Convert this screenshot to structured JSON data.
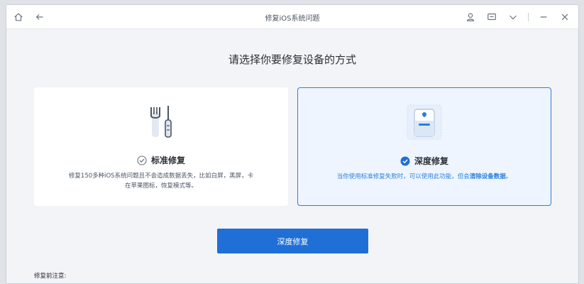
{
  "window": {
    "title": "修复iOS系统问题"
  },
  "titlebar": {
    "left_icons": [
      "home-icon",
      "back-arrow-icon"
    ],
    "right_icons": [
      "user-icon",
      "chat-icon",
      "chevron-down-icon",
      "minimize-icon",
      "close-icon"
    ]
  },
  "main": {
    "heading": "请选择你要修复设备的方式"
  },
  "modes": {
    "standard": {
      "title": "标准修复",
      "desc_line1": "修复150多种iOS系统问题且不会造成数据丢失，比如白屏，黑屏，卡",
      "desc_line2": "在苹果图标，恢复模式等。",
      "icon": "tools-icon",
      "selected": false
    },
    "deep": {
      "title": "深度修复",
      "desc_prefix": "当你使用标准修复失败时，可以使用此功能，但会",
      "desc_strong": "清除设备数据",
      "desc_suffix": "。",
      "icon": "phone-device-icon",
      "selected": true
    }
  },
  "actions": {
    "primary_label": "深度修复"
  },
  "notes": {
    "label": "修复前注意:"
  },
  "colors": {
    "accent": "#1f6fd6",
    "selected_border": "#2b7fd9",
    "selected_bg": "#eef5ff"
  }
}
